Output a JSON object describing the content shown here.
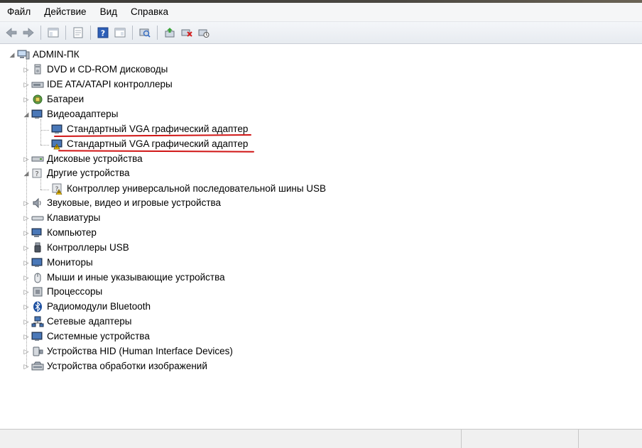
{
  "menu": [
    "Файл",
    "Действие",
    "Вид",
    "Справка"
  ],
  "toolbar": {
    "icons": [
      "back-arrow-icon",
      "forward-arrow-icon",
      "show-hide-tree-icon",
      "properties-icon",
      "help-icon",
      "view-icon",
      "scan-hardware-icon",
      "update-driver-icon",
      "uninstall-icon",
      "disable-device-icon"
    ]
  },
  "tree": {
    "root": "ADMIN-ПК",
    "categories": [
      {
        "label": "DVD и CD-ROM дисководы",
        "icon": "dvd-drive-icon",
        "expanded": false,
        "children": []
      },
      {
        "label": "IDE ATA/ATAPI контроллеры",
        "icon": "ide-controller-icon",
        "expanded": false,
        "children": []
      },
      {
        "label": "Батареи",
        "icon": "battery-icon",
        "expanded": false,
        "children": []
      },
      {
        "label": "Видеоадаптеры",
        "icon": "display-adapter-icon",
        "expanded": true,
        "children": [
          {
            "label": "Стандартный VGA графический адаптер",
            "icon": "display-adapter-icon",
            "warning": false
          },
          {
            "label": "Стандартный VGA графический адаптер",
            "icon": "display-adapter-warning-icon",
            "warning": true
          }
        ]
      },
      {
        "label": "Дисковые устройства",
        "icon": "disk-drive-icon",
        "expanded": false,
        "children": []
      },
      {
        "label": "Другие устройства",
        "icon": "unknown-device-icon",
        "expanded": true,
        "children": [
          {
            "label": "Контроллер универсальной последовательной шины USB",
            "icon": "unknown-device-warning-icon",
            "warning": true
          }
        ]
      },
      {
        "label": "Звуковые, видео и игровые устройства",
        "icon": "speaker-icon",
        "expanded": false,
        "children": []
      },
      {
        "label": "Клавиатуры",
        "icon": "keyboard-icon",
        "expanded": false,
        "children": []
      },
      {
        "label": "Компьютер",
        "icon": "computer-icon",
        "expanded": false,
        "children": []
      },
      {
        "label": "Контроллеры USB",
        "icon": "usb-icon",
        "expanded": false,
        "children": []
      },
      {
        "label": "Мониторы",
        "icon": "monitor-icon",
        "expanded": false,
        "children": []
      },
      {
        "label": "Мыши и иные указывающие устройства",
        "icon": "mouse-icon",
        "expanded": false,
        "children": []
      },
      {
        "label": "Процессоры",
        "icon": "processor-icon",
        "expanded": false,
        "children": []
      },
      {
        "label": "Радиомодули Bluetooth",
        "icon": "bluetooth-icon",
        "expanded": false,
        "children": []
      },
      {
        "label": "Сетевые адаптеры",
        "icon": "network-adapter-icon",
        "expanded": false,
        "children": []
      },
      {
        "label": "Системные устройства",
        "icon": "system-device-icon",
        "expanded": false,
        "children": []
      },
      {
        "label": "Устройства HID (Human Interface Devices)",
        "icon": "hid-icon",
        "expanded": false,
        "children": []
      },
      {
        "label": "Устройства обработки изображений",
        "icon": "imaging-device-icon",
        "expanded": false,
        "children": []
      }
    ]
  },
  "colors": {
    "annotation": "#d01515",
    "warning": "#f2c200"
  }
}
